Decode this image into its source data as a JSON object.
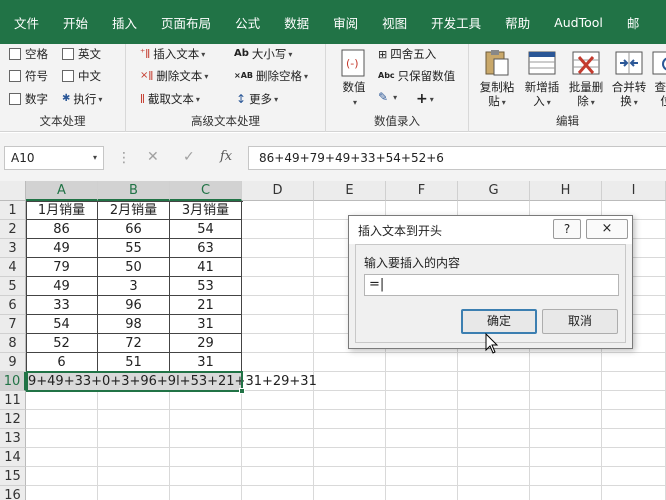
{
  "menu": [
    "文件",
    "开始",
    "插入",
    "页面布局",
    "公式",
    "数据",
    "审阅",
    "视图",
    "开发工具",
    "帮助",
    "AudTool",
    "邮"
  ],
  "ribbon": {
    "group1": {
      "title": "文本处理",
      "items": [
        "空格",
        "英文",
        "符号",
        "中文",
        "数字",
        "执行"
      ]
    },
    "group2": {
      "title": "高级文本处理",
      "items": [
        "插入文本",
        "删除文本",
        "截取文本",
        "大小写",
        "删除空格",
        "更多"
      ]
    },
    "group3": {
      "title": "数值录入",
      "big": "数值",
      "items": [
        "四舍五入",
        "只保留数值"
      ]
    },
    "group4": {
      "title": "编辑",
      "buttons": [
        "复制粘贴",
        "新增插入",
        "批量删除",
        "合并转换",
        "查找定位"
      ],
      "buttons_line2": [
        "贴",
        "入",
        "除",
        "换",
        "位"
      ],
      "buttons_line1": [
        "复制粘",
        "新增插",
        "批量删",
        "合并转",
        "查找"
      ]
    }
  },
  "formula_bar": {
    "name_box": "A10",
    "formula": "86+49+79+49+33+54+52+6"
  },
  "grid": {
    "columns": [
      "A",
      "B",
      "C",
      "D",
      "E",
      "F",
      "G",
      "H",
      "I"
    ],
    "rows": [
      "1",
      "2",
      "3",
      "4",
      "5",
      "6",
      "7",
      "8",
      "9",
      "10",
      "11",
      "12",
      "13",
      "14",
      "15",
      "16"
    ],
    "header_row": [
      "1月销量",
      "2月销量",
      "3月销量"
    ],
    "data": [
      [
        "86",
        "66",
        "54"
      ],
      [
        "49",
        "55",
        "63"
      ],
      [
        "79",
        "50",
        "41"
      ],
      [
        "49",
        "3",
        "53"
      ],
      [
        "33",
        "96",
        "21"
      ],
      [
        "54",
        "98",
        "31"
      ],
      [
        "52",
        "72",
        "29"
      ],
      [
        "6",
        "51",
        "31"
      ]
    ],
    "row10_text": "9+49+33+0+3+96+9l+53+21+31+29+31"
  },
  "dialog": {
    "title": "插入文本到开头",
    "help_button": "?",
    "close_button": "×",
    "prompt": "输入要插入的内容",
    "input_value": "=|",
    "ok": "确定",
    "cancel": "取消"
  }
}
